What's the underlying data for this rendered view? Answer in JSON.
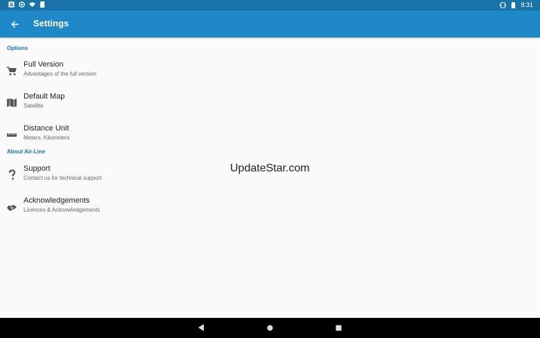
{
  "status_bar": {
    "time": "8:31",
    "icons_left": [
      "notification-a-icon",
      "sync-icon",
      "wifi-icon",
      "sd-card-icon"
    ],
    "icons_right": [
      "vibrate-icon",
      "battery-icon"
    ]
  },
  "toolbar": {
    "title": "Settings",
    "back_icon": "arrow-left-icon"
  },
  "sections": [
    {
      "header": "Options",
      "items": [
        {
          "title": "Full Version",
          "subtitle": "Advantages of the full version",
          "icon": "cart-icon"
        },
        {
          "title": "Default Map",
          "subtitle": "Satellite",
          "icon": "map-icon"
        },
        {
          "title": "Distance Unit",
          "subtitle": "Meters, Kilometers",
          "icon": "ruler-icon"
        }
      ]
    },
    {
      "header": "About Air-Line",
      "items": [
        {
          "title": "Support",
          "subtitle": "Contact us for technical support",
          "icon": "question-icon"
        },
        {
          "title": "Acknowledgements",
          "subtitle": "Licences & Acknowledgements",
          "icon": "handshake-icon"
        }
      ]
    }
  ],
  "watermark": "UpdateStar.com",
  "nav_bar": {
    "back_icon": "nav-back-icon",
    "home_icon": "nav-home-icon",
    "recents_icon": "nav-recents-icon"
  },
  "colors": {
    "status_bar": "#1a73a7",
    "toolbar": "#1e88c8",
    "section_header": "#1a73a7",
    "background": "#fafafa"
  }
}
